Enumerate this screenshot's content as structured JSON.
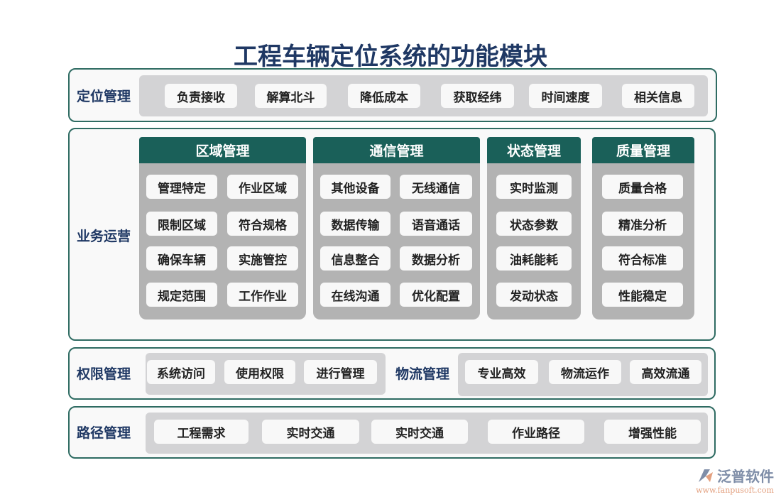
{
  "title": "工程车辆定位系统的功能模块",
  "rows": {
    "positioning": {
      "label": "定位管理",
      "items": [
        "负责接收",
        "解算北斗",
        "降低成本",
        "获取经纬",
        "时间速度",
        "相关信息"
      ]
    },
    "operations": {
      "label": "业务运营",
      "groups": [
        {
          "title": "区域管理",
          "items": [
            "管理特定",
            "作业区域",
            "限制区域",
            "符合规格",
            "确保车辆",
            "实施管控",
            "规定范围",
            "工作作业"
          ]
        },
        {
          "title": "通信管理",
          "items": [
            "其他设备",
            "无线通信",
            "数据传输",
            "语音通话",
            "信息整合",
            "数据分析",
            "在线沟通",
            "优化配置"
          ]
        },
        {
          "title": "状态管理",
          "items": [
            "实时监测",
            "状态参数",
            "油耗能耗",
            "发动状态"
          ]
        },
        {
          "title": "质量管理",
          "items": [
            "质量合格",
            "精准分析",
            "符合标准",
            "性能稳定"
          ]
        }
      ]
    },
    "permission": {
      "label": "权限管理",
      "items": [
        "系统访问",
        "使用权限",
        "进行管理"
      ]
    },
    "logistics": {
      "label": "物流管理",
      "items": [
        "专业高效",
        "物流运作",
        "高效流通"
      ]
    },
    "route": {
      "label": "路径管理",
      "items": [
        "工程需求",
        "实时交通",
        "实时交通",
        "作业路径",
        "增强性能"
      ]
    }
  },
  "logo": {
    "name": "泛普软件",
    "url": "www.fanpusoft.com"
  },
  "colors": {
    "title": "#1f3864",
    "border": "#2e6b62",
    "header": "#1a6059"
  }
}
